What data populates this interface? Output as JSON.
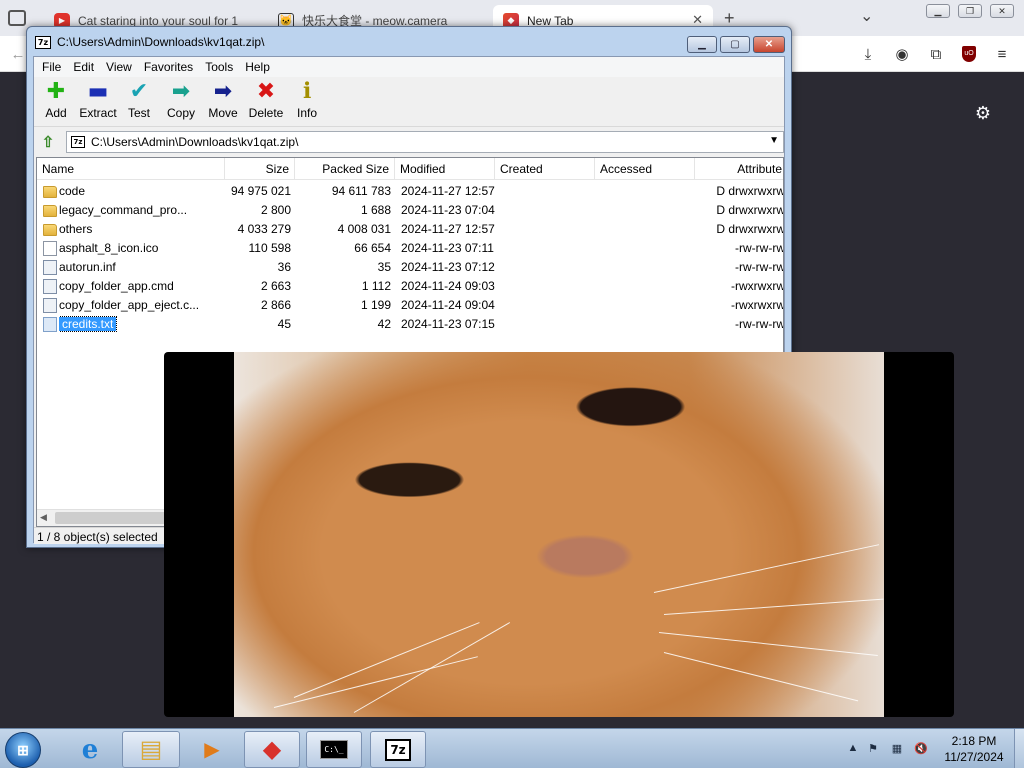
{
  "browser": {
    "tabs": [
      {
        "title": "Cat staring into your soul for 1",
        "favicon": "youtube-icon",
        "active": false
      },
      {
        "title": "快乐大食堂 - meow.camera",
        "favicon": "cat-icon",
        "active": false
      },
      {
        "title": "New Tab",
        "favicon": "firefox-icon",
        "active": true
      }
    ],
    "new_tab_label": "+",
    "list_tabs_label": "⌄"
  },
  "zip": {
    "title": "C:\\Users\\Admin\\Downloads\\kv1qat.zip\\",
    "app_icon_text": "7z",
    "menu": [
      "File",
      "Edit",
      "View",
      "Favorites",
      "Tools",
      "Help"
    ],
    "toolbar": [
      {
        "label": "Add",
        "glyph": "✚",
        "color": "#22b214"
      },
      {
        "label": "Extract",
        "glyph": "▬",
        "color": "#1b2fb4"
      },
      {
        "label": "Test",
        "glyph": "✔",
        "color": "#1aa3b3"
      },
      {
        "label": "Copy",
        "glyph": "➡",
        "color": "#19a18e"
      },
      {
        "label": "Move",
        "glyph": "➡",
        "color": "#16228e"
      },
      {
        "label": "Delete",
        "glyph": "✖",
        "color": "#d81616"
      },
      {
        "label": "Info",
        "glyph": "ℹ",
        "color": "#a38f00"
      }
    ],
    "address": "C:\\Users\\Admin\\Downloads\\kv1qat.zip\\",
    "columns": [
      "Name",
      "Size",
      "Packed Size",
      "Modified",
      "Created",
      "Accessed",
      "Attribute"
    ],
    "rows": [
      {
        "name": "code",
        "type": "folder",
        "size": "94 975 021",
        "packed": "94 611 783",
        "modified": "2024-11-27 12:57",
        "created": "",
        "accessed": "",
        "attr": "D drwxrwxrw"
      },
      {
        "name": "legacy_command_pro...",
        "type": "folder",
        "size": "2 800",
        "packed": "1 688",
        "modified": "2024-11-23 07:04",
        "created": "",
        "accessed": "",
        "attr": "D drwxrwxrw"
      },
      {
        "name": "others",
        "type": "folder",
        "size": "4 033 279",
        "packed": "4 008 031",
        "modified": "2024-11-27 12:57",
        "created": "",
        "accessed": "",
        "attr": "D drwxrwxrw"
      },
      {
        "name": "asphalt_8_icon.ico",
        "type": "file",
        "size": "110 598",
        "packed": "66 654",
        "modified": "2024-11-23 07:11",
        "created": "",
        "accessed": "",
        "attr": "-rw-rw-rw"
      },
      {
        "name": "autorun.inf",
        "type": "config",
        "size": "36",
        "packed": "35",
        "modified": "2024-11-23 07:12",
        "created": "",
        "accessed": "",
        "attr": "-rw-rw-rw"
      },
      {
        "name": "copy_folder_app.cmd",
        "type": "config",
        "size": "2 663",
        "packed": "1 112",
        "modified": "2024-11-24 09:03",
        "created": "",
        "accessed": "",
        "attr": "-rwxrwxrw"
      },
      {
        "name": "copy_folder_app_eject.c...",
        "type": "config",
        "size": "2 866",
        "packed": "1 199",
        "modified": "2024-11-24 09:04",
        "created": "",
        "accessed": "",
        "attr": "-rwxrwxrw"
      },
      {
        "name": "credits.txt",
        "type": "text",
        "size": "45",
        "packed": "42",
        "modified": "2024-11-23 07:15",
        "created": "",
        "accessed": "",
        "attr": "-rw-rw-rw",
        "selected": true
      }
    ],
    "status": "1 / 8 object(s) selected"
  },
  "taskbar": {
    "apps": [
      {
        "name": "internet-explorer-icon",
        "glyph": "e",
        "color": "#1f7fd6"
      },
      {
        "name": "file-explorer-icon",
        "glyph": "▤",
        "color": "#d9a93a"
      },
      {
        "name": "media-player-icon",
        "glyph": "▶",
        "color": "#e07b1a"
      },
      {
        "name": "firefox-icon",
        "glyph": "◆",
        "color": "#d8322c"
      },
      {
        "name": "command-prompt-icon",
        "glyph": "C:\\_",
        "color": "#000000"
      },
      {
        "name": "7zip-icon",
        "glyph": "7z",
        "color": "#000000"
      }
    ],
    "clock_time": "2:18 PM",
    "clock_date": "11/27/2024"
  }
}
